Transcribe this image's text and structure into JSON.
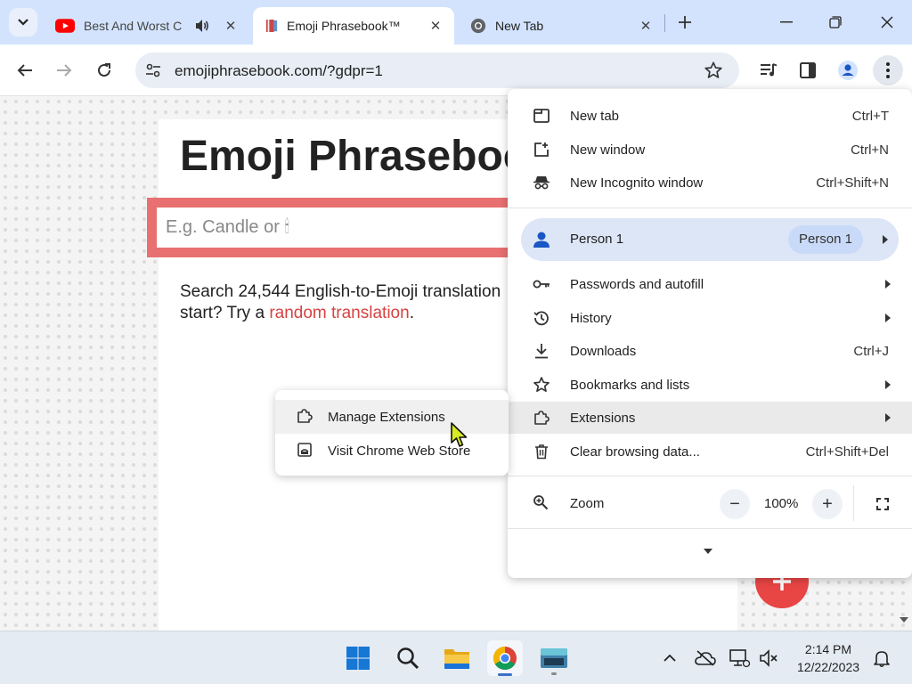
{
  "tabs": [
    {
      "title": "Best And Worst C",
      "icon": "youtube-icon",
      "audio": true,
      "active": false
    },
    {
      "title": "Emoji Phrasebook™",
      "icon": "book-icon",
      "active": true
    },
    {
      "title": "New Tab",
      "icon": "chrome-icon",
      "active": false
    }
  ],
  "toolbar": {
    "url": "emojiphrasebook.com/?gdpr=1"
  },
  "page": {
    "title": "Emoji Phraseboo",
    "search_placeholder": "E.g. Candle or 🕯",
    "desc_before": "Search 24,544 English-to-Emoji translation",
    "desc_line2": "start? Try a ",
    "desc_link": "random translation",
    "desc_after": "."
  },
  "menu": {
    "new_tab": {
      "label": "New tab",
      "shortcut": "Ctrl+T"
    },
    "new_window": {
      "label": "New window",
      "shortcut": "Ctrl+N"
    },
    "incognito": {
      "label": "New Incognito window",
      "shortcut": "Ctrl+Shift+N"
    },
    "profile": {
      "label": "Person 1",
      "chip": "Person 1"
    },
    "passwords": {
      "label": "Passwords and autofill"
    },
    "history": {
      "label": "History"
    },
    "downloads": {
      "label": "Downloads",
      "shortcut": "Ctrl+J"
    },
    "bookmarks": {
      "label": "Bookmarks and lists"
    },
    "extensions": {
      "label": "Extensions"
    },
    "clear": {
      "label": "Clear browsing data...",
      "shortcut": "Ctrl+Shift+Del"
    },
    "zoom": {
      "label": "Zoom",
      "minus": "−",
      "value": "100%",
      "plus": "+"
    }
  },
  "submenu": {
    "manage": "Manage Extensions",
    "webstore": "Visit Chrome Web Store"
  },
  "taskbar": {
    "time": "2:14 PM",
    "date": "12/22/2023"
  },
  "colors": {
    "tabstrip": "#d3e3fd",
    "search_border": "#e87070",
    "link": "#d64242",
    "fab": "#e84545",
    "profile_row": "#dde6f7"
  }
}
